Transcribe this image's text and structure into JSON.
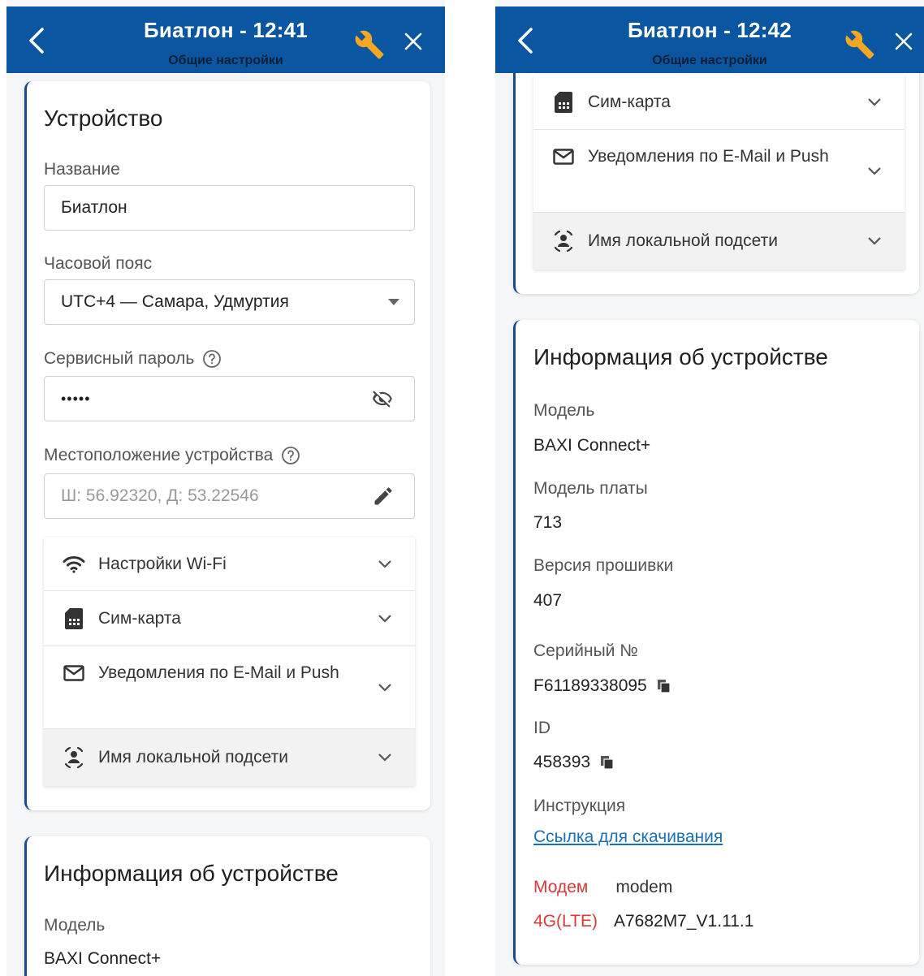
{
  "colors": {
    "appbar": "#0a56a0",
    "accent_wrench": "#f5a623",
    "card_border": "#1b4a87",
    "link": "#1c6fb6",
    "modem_label": "#d63a3a"
  },
  "left": {
    "header": {
      "title": "Биатлон - 12:41",
      "subtitle": "Общие настройки"
    },
    "device": {
      "title": "Устройство",
      "name_label": "Название",
      "name_value": "Биатлон",
      "tz_label": "Часовой пояс",
      "tz_value": "UTC+4 — Самара, Удмуртия",
      "pw_label": "Сервисный пароль",
      "pw_value": "•••••",
      "loc_label": "Местоположение устройства",
      "loc_placeholder": "Ш: 56.92320, Д: 53.22546",
      "sections": [
        {
          "icon": "wifi-icon",
          "label": "Настройки Wi-Fi"
        },
        {
          "icon": "sim-card-icon",
          "label": "Сим-карта"
        },
        {
          "icon": "mail-icon",
          "label": "Уведомления по E-Mail и Push"
        },
        {
          "icon": "subnet-icon",
          "label": "Имя локальной подсети"
        }
      ]
    },
    "info": {
      "title": "Информация об устройстве",
      "model_label": "Модель",
      "model_value": "BAXI Connect+"
    }
  },
  "right": {
    "header": {
      "title": "Биатлон - 12:42",
      "subtitle": "Общие настройки"
    },
    "sections": [
      {
        "icon": "sim-card-icon",
        "label": "Сим-карта"
      },
      {
        "icon": "mail-icon",
        "label": "Уведомления по E-Mail и Push"
      },
      {
        "icon": "subnet-icon",
        "label": "Имя локальной подсети"
      }
    ],
    "info": {
      "title": "Информация об устройстве",
      "model_label": "Модель",
      "model_value": "BAXI Connect+",
      "board_label": "Модель платы",
      "board_value": "713",
      "fw_label": "Версия прошивки",
      "fw_value": "407",
      "serial_label": "Серийный №",
      "serial_value": "F61189338095",
      "id_label": "ID",
      "id_value": "458393",
      "manual_label": "Инструкция",
      "manual_link": "Ссылка для скачивания",
      "modem_label": "Модем",
      "modem_value": "modem",
      "lte_label": "4G(LTE)",
      "lte_value": "A7682M7_V1.11.1"
    }
  }
}
